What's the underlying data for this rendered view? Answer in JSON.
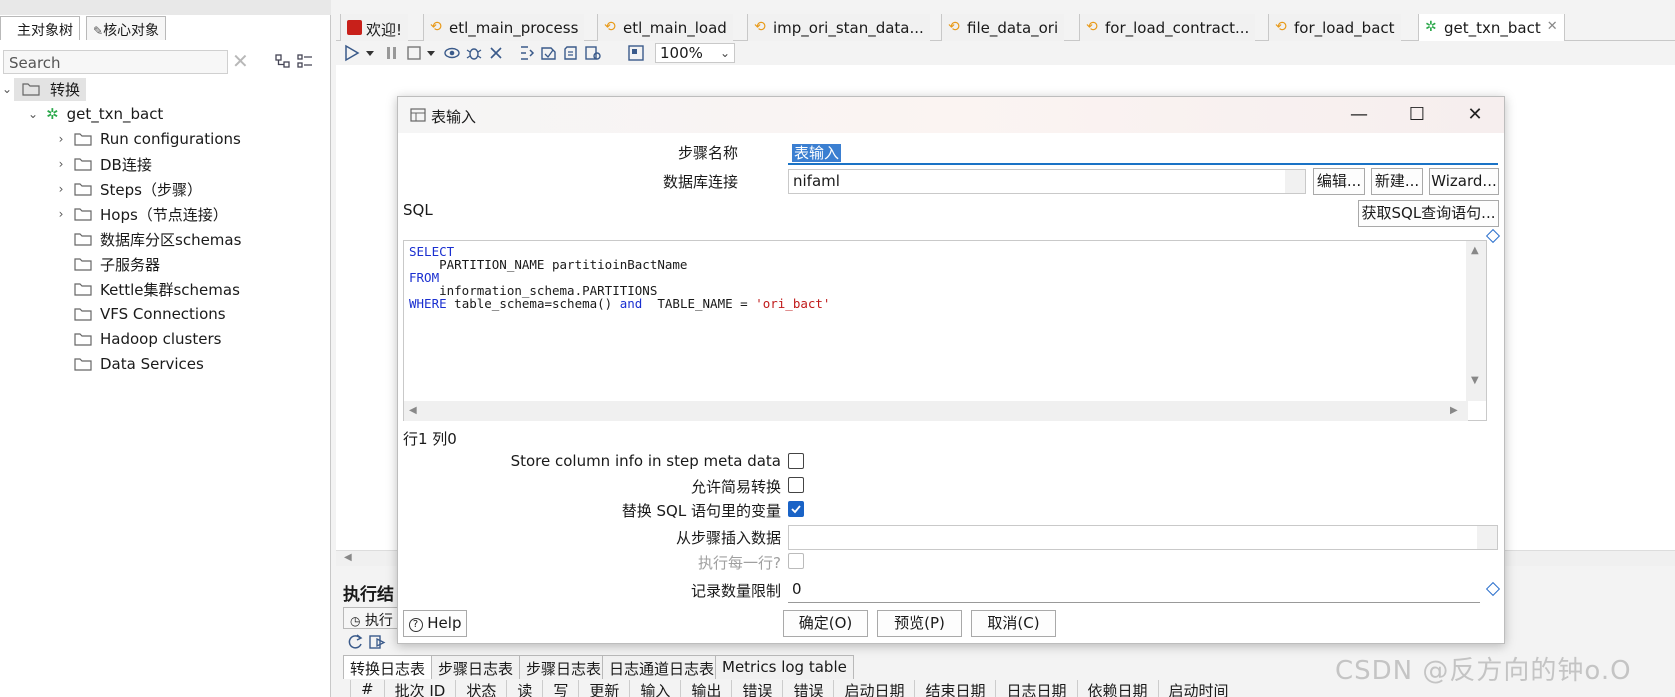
{
  "left_panel": {
    "tabs": [
      "主对象树",
      "核心对象"
    ],
    "search_placeholder": "Search",
    "tree": {
      "root": "转换",
      "transformation": "get_txn_bact",
      "children": [
        "Run configurations",
        "DB连接",
        "Steps（步骤）",
        "Hops（节点连接）",
        "数据库分区schemas",
        "子服务器",
        "Kettle集群schemas",
        "VFS Connections",
        "Hadoop clusters",
        "Data Services"
      ]
    }
  },
  "editor_tabs": [
    "欢迎!",
    "etl_main_process",
    "etl_main_load",
    "imp_ori_stan_data...",
    "file_data_ori",
    "for_load_contract...",
    "for_load_bact",
    "get_txn_bact"
  ],
  "toolbar": {
    "zoom": "100%"
  },
  "exec": {
    "title": "执行结",
    "subtab": "执行",
    "log_tabs": [
      "转换日志表",
      "步骤日志表",
      "步骤日志表",
      "日志通道日志表",
      "Metrics log table"
    ],
    "columns": [
      "#",
      "批次 ID",
      "状态",
      "读",
      "写",
      "更新",
      "输入",
      "输出",
      "错误",
      "错误",
      "启动日期",
      "结束日期",
      "日志日期",
      "依赖日期",
      "启动时间"
    ]
  },
  "dialog": {
    "title": "表输入",
    "step_name_label": "步骤名称",
    "step_name_value": "表输入",
    "db_conn_label": "数据库连接",
    "db_conn_value": "nifaml",
    "edit_btn": "编辑...",
    "new_btn": "新建...",
    "wizard_btn": "Wizard...",
    "sql_label": "SQL",
    "get_sql_btn": "获取SQL查询语句...",
    "sql": {
      "l1": "SELECT",
      "l2": "    PARTITION_NAME partitioinBactName",
      "l3": "FROM",
      "l4": "    information_schema.PARTITIONS",
      "l5_kw1": "WHERE",
      "l5_a": " table_schema=schema() ",
      "l5_kw2": "and",
      "l5_b": "  TABLE_NAME = ",
      "l5_str": "'ori_bact'"
    },
    "cursor_pos": "行1 列0",
    "opt_store_col": "Store column info in step meta data",
    "opt_lazy": "允许简易转换",
    "opt_replace_vars": "替换 SQL 语句里的变量",
    "insert_from_label": "从步骤插入数据",
    "exec_each_label": "执行每一行?",
    "limit_label": "记录数量限制",
    "limit_value": "0",
    "help_btn": "Help",
    "ok_btn": "确定(O)",
    "preview_btn": "预览(P)",
    "cancel_btn": "取消(C)",
    "checks": {
      "store_col": false,
      "lazy": false,
      "replace_vars": true,
      "exec_each": false
    }
  },
  "watermark": "CSDN @反方向的钟o.O",
  "colors": {
    "accent": "#1a63c6",
    "keyword": "#1a2fd0",
    "string": "#c01a1a"
  }
}
